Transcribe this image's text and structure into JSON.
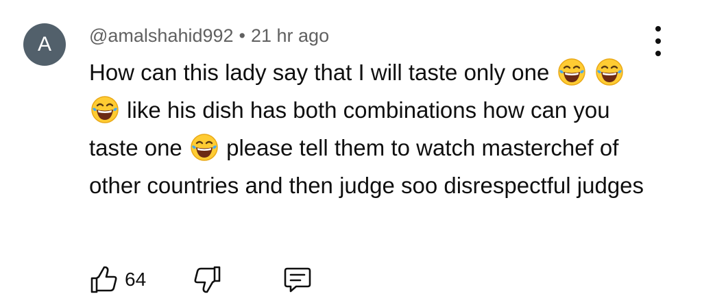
{
  "avatar": {
    "letter": "A",
    "color": "#52606b"
  },
  "comment": {
    "author": "@amalshahid992",
    "separator": "•",
    "time": "21 hr ago",
    "segments": [
      "How can this lady say that I will taste only one",
      "like his dish has both combinations how can you taste one",
      "please tell them to watch masterchef of other countries and then judge soo disrespectful judges"
    ],
    "emoji": "face-with-tears-of-joy-icon"
  },
  "actions": {
    "like_count": "64",
    "icons": [
      "thumbs-up-icon",
      "thumbs-down-icon",
      "reply-icon"
    ]
  },
  "menu": {
    "icon": "more-vert-icon"
  }
}
